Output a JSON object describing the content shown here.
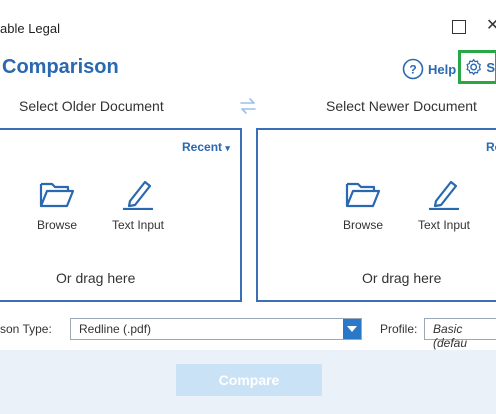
{
  "window": {
    "title": "able Legal"
  },
  "header": {
    "title": "Comparison",
    "help_label": "Help",
    "settings_label": "S"
  },
  "older": {
    "heading": "Select Older Document",
    "recent_label": "Recent",
    "browse_label": "Browse",
    "text_input_label": "Text Input",
    "drag_label": "Or drag here"
  },
  "newer": {
    "heading": "Select Newer Document",
    "recent_label": "Re",
    "browse_label": "Browse",
    "text_input_label": "Text Input",
    "drag_label": "Or drag here"
  },
  "options": {
    "comparison_type_label": "son Type:",
    "comparison_type_value": "Redline (.pdf)",
    "profile_label": "Profile:",
    "profile_value": "Basic (defau"
  },
  "footer": {
    "compare_label": "Compare"
  },
  "colors": {
    "accent": "#2a68b0",
    "highlight": "#28a745",
    "footer_bg": "#eaf1f9",
    "compare_disabled": "#c9e2f5"
  }
}
